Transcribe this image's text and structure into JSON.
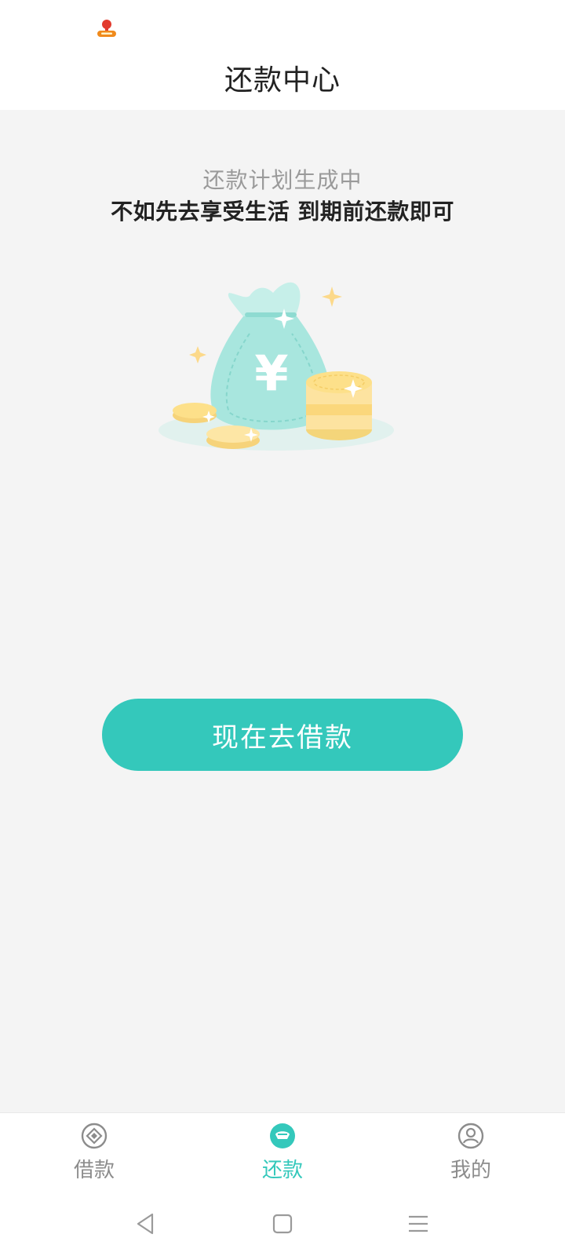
{
  "header": {
    "title": "还款中心"
  },
  "empty_state": {
    "subtitle": "还款计划生成中",
    "message": "不如先去享受生活 到期前还款即可",
    "illustration_icon": "money-bag-with-coins",
    "currency_symbol": "¥"
  },
  "cta": {
    "label": "现在去借款"
  },
  "tabs": [
    {
      "label": "借款",
      "icon": "loan-icon",
      "active": false
    },
    {
      "label": "还款",
      "icon": "repay-icon",
      "active": true
    },
    {
      "label": "我的",
      "icon": "profile-icon",
      "active": false
    }
  ],
  "system_nav": [
    "back",
    "home",
    "menu"
  ],
  "colors": {
    "accent": "#34c8bb",
    "background": "#f4f4f4",
    "text_primary": "#222222",
    "text_secondary": "#9a9a9a",
    "tab_inactive": "#8c8c8c",
    "coin": "#fde08a",
    "bag": "#a8e6de"
  }
}
